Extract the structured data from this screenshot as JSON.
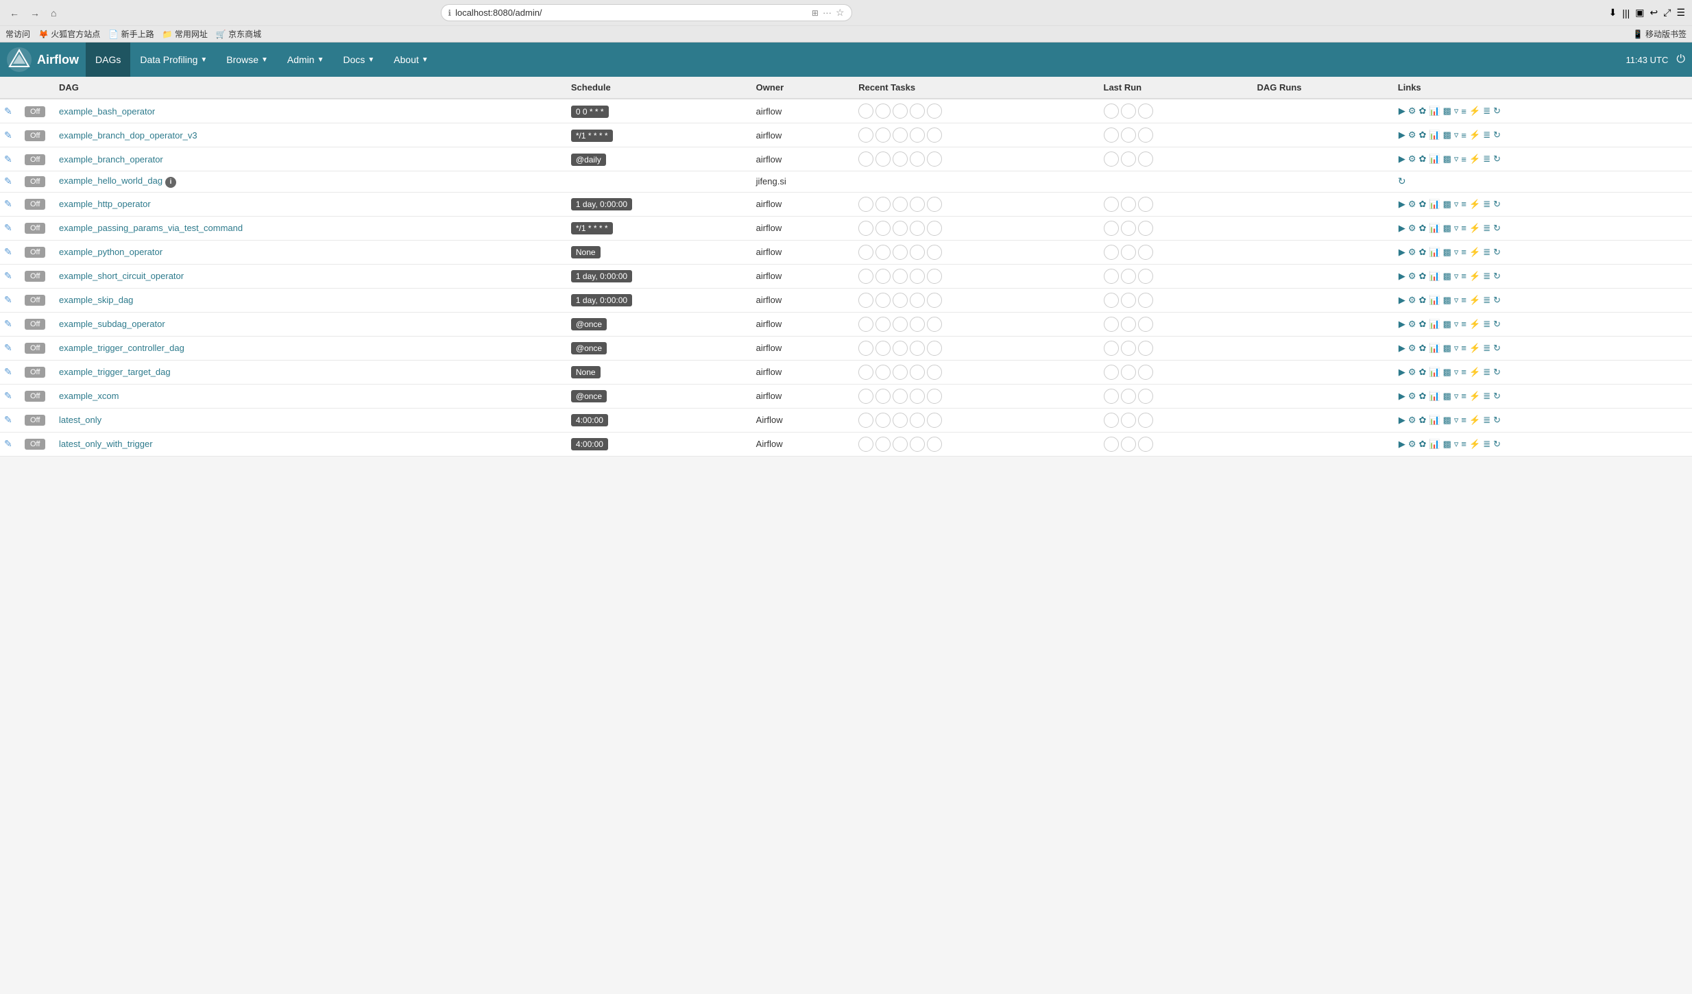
{
  "browser": {
    "url": "localhost:8080/admin/",
    "back_title": "back",
    "forward_title": "forward",
    "home_title": "home",
    "bookmarks": [
      {
        "label": "常访问",
        "icon": "★"
      },
      {
        "label": "火狐官方站点",
        "icon": "🦊"
      },
      {
        "label": "新手上路",
        "icon": "📄"
      },
      {
        "label": "常用网址",
        "icon": "📁"
      },
      {
        "label": "京东商城",
        "icon": "🛒"
      }
    ]
  },
  "nav": {
    "logo_text": "Airflow",
    "items": [
      {
        "label": "DAGs",
        "active": true,
        "has_arrow": false
      },
      {
        "label": "Data Profiling",
        "active": false,
        "has_arrow": true
      },
      {
        "label": "Browse",
        "active": false,
        "has_arrow": true
      },
      {
        "label": "Admin",
        "active": false,
        "has_arrow": true
      },
      {
        "label": "Docs",
        "active": false,
        "has_arrow": true
      },
      {
        "label": "About",
        "active": false,
        "has_arrow": true
      }
    ],
    "time": "11:43 UTC"
  },
  "table": {
    "dags": [
      {
        "name": "example_bash_operator",
        "schedule": "0 0 * * *",
        "owner": "airflow",
        "has_info": false,
        "runs": 5,
        "recent_runs": 5,
        "actions": true,
        "only_refresh": false
      },
      {
        "name": "example_branch_dop_operator_v3",
        "schedule": "*/1 * * * *",
        "owner": "airflow",
        "has_info": false,
        "runs": 5,
        "recent_runs": 5,
        "actions": true,
        "only_refresh": false
      },
      {
        "name": "example_branch_operator",
        "schedule": "@daily",
        "owner": "airflow",
        "has_info": false,
        "runs": 5,
        "recent_runs": 5,
        "actions": true,
        "only_refresh": false
      },
      {
        "name": "example_hello_world_dag",
        "schedule": "",
        "owner": "jifeng.si",
        "has_info": true,
        "runs": 0,
        "recent_runs": 0,
        "actions": false,
        "only_refresh": true
      },
      {
        "name": "example_http_operator",
        "schedule": "1 day, 0:00:00",
        "owner": "airflow",
        "has_info": false,
        "runs": 5,
        "recent_runs": 5,
        "actions": true,
        "only_refresh": false
      },
      {
        "name": "example_passing_params_via_test_command",
        "schedule": "*/1 * * * *",
        "owner": "airflow",
        "has_info": false,
        "runs": 5,
        "recent_runs": 5,
        "actions": true,
        "only_refresh": false
      },
      {
        "name": "example_python_operator",
        "schedule": "None",
        "owner": "airflow",
        "has_info": false,
        "runs": 5,
        "recent_runs": 5,
        "actions": true,
        "only_refresh": false
      },
      {
        "name": "example_short_circuit_operator",
        "schedule": "1 day, 0:00:00",
        "owner": "airflow",
        "has_info": false,
        "runs": 5,
        "recent_runs": 5,
        "actions": true,
        "only_refresh": false
      },
      {
        "name": "example_skip_dag",
        "schedule": "1 day, 0:00:00",
        "owner": "airflow",
        "has_info": false,
        "runs": 5,
        "recent_runs": 5,
        "actions": true,
        "only_refresh": false
      },
      {
        "name": "example_subdag_operator",
        "schedule": "@once",
        "owner": "airflow",
        "has_info": false,
        "runs": 5,
        "recent_runs": 5,
        "actions": true,
        "only_refresh": false
      },
      {
        "name": "example_trigger_controller_dag",
        "schedule": "@once",
        "owner": "airflow",
        "has_info": false,
        "runs": 5,
        "recent_runs": 5,
        "actions": true,
        "only_refresh": false
      },
      {
        "name": "example_trigger_target_dag",
        "schedule": "None",
        "owner": "airflow",
        "has_info": false,
        "runs": 5,
        "recent_runs": 5,
        "actions": true,
        "only_refresh": false
      },
      {
        "name": "example_xcom",
        "schedule": "@once",
        "owner": "airflow",
        "has_info": false,
        "runs": 5,
        "recent_runs": 5,
        "actions": true,
        "only_refresh": false
      },
      {
        "name": "latest_only",
        "schedule": "4:00:00",
        "owner": "Airflow",
        "has_info": false,
        "runs": 5,
        "recent_runs": 5,
        "actions": true,
        "only_refresh": false
      },
      {
        "name": "latest_only_with_trigger",
        "schedule": "4:00:00",
        "owner": "Airflow",
        "has_info": false,
        "runs": 5,
        "recent_runs": 5,
        "actions": true,
        "only_refresh": false
      }
    ]
  },
  "labels": {
    "off": "Off",
    "edit_icon": "✎",
    "info_icon": "ℹ"
  }
}
